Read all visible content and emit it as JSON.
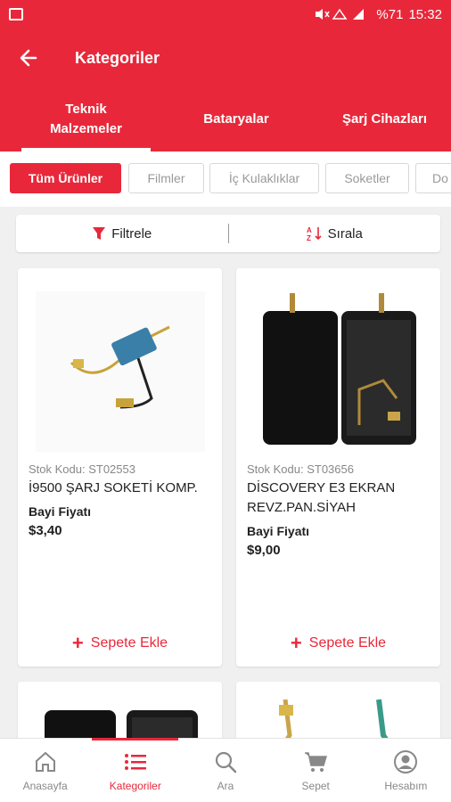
{
  "status_bar": {
    "signal_text": "%71",
    "time": "15:32"
  },
  "app_bar": {
    "title": "Kategoriler",
    "back_icon": "arrow-left-icon"
  },
  "tabs": [
    {
      "label_line1": "Teknik",
      "label_line2": "Malzemeler"
    },
    {
      "label": "Bataryalar"
    },
    {
      "label": "Şarj Cihazları"
    }
  ],
  "chips": [
    {
      "label": "Tüm Ürünler"
    },
    {
      "label": "Filmler"
    },
    {
      "label": "İç Kulaklıklar"
    },
    {
      "label": "Soketler"
    },
    {
      "label": "Do"
    }
  ],
  "toolbar": {
    "filter_label": "Filtrele",
    "sort_label": "Sırala"
  },
  "products": [
    {
      "sku": "Stok Kodu: ST02553",
      "name": "İ9500 ŞARJ SOKETİ KOMP.",
      "dealer_label": "Bayi Fiyatı",
      "price": "$3,40",
      "add_label": "Sepete Ekle"
    },
    {
      "sku": "Stok Kodu: ST03656",
      "name": "DİSCOVERY E3 EKRAN REVZ.PAN.SİYAH",
      "dealer_label": "Bayi Fiyatı",
      "price": "$9,00",
      "add_label": "Sepete Ekle"
    }
  ],
  "bottom_nav": [
    {
      "label": "Anasayfa",
      "icon": "home-icon"
    },
    {
      "label": "Kategoriler",
      "icon": "list-icon"
    },
    {
      "label": "Ara",
      "icon": "search-icon"
    },
    {
      "label": "Sepet",
      "icon": "cart-icon"
    },
    {
      "label": "Hesabım",
      "icon": "account-icon"
    }
  ],
  "colors": {
    "brand": "#e8283a"
  }
}
